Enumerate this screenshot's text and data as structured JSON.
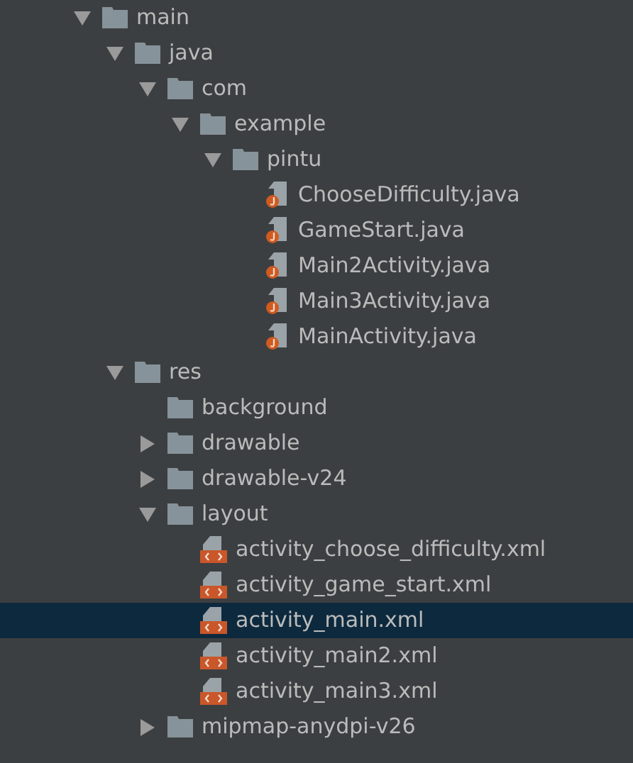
{
  "tree": [
    {
      "name": "main",
      "kind": "folder",
      "expanded": true,
      "selected": false,
      "children": [
        {
          "name": "java",
          "kind": "folder",
          "expanded": true,
          "selected": false,
          "children": [
            {
              "name": "com",
              "kind": "folder",
              "expanded": true,
              "selected": false,
              "children": [
                {
                  "name": "example",
                  "kind": "folder",
                  "expanded": true,
                  "selected": false,
                  "children": [
                    {
                      "name": "pintu",
                      "kind": "folder",
                      "expanded": true,
                      "selected": false,
                      "children": [
                        {
                          "name": "ChooseDifficulty.java",
                          "kind": "java",
                          "selected": false
                        },
                        {
                          "name": "GameStart.java",
                          "kind": "java",
                          "selected": false
                        },
                        {
                          "name": "Main2Activity.java",
                          "kind": "java",
                          "selected": false
                        },
                        {
                          "name": "Main3Activity.java",
                          "kind": "java",
                          "selected": false
                        },
                        {
                          "name": "MainActivity.java",
                          "kind": "java",
                          "selected": false
                        }
                      ]
                    }
                  ]
                }
              ]
            }
          ]
        },
        {
          "name": "res",
          "kind": "folder",
          "expanded": true,
          "selected": false,
          "children": [
            {
              "name": "background",
              "kind": "folder",
              "selected": false
            },
            {
              "name": "drawable",
              "kind": "folder",
              "expanded": false,
              "selected": false
            },
            {
              "name": "drawable-v24",
              "kind": "folder",
              "expanded": false,
              "selected": false
            },
            {
              "name": "layout",
              "kind": "folder",
              "expanded": true,
              "selected": false,
              "children": [
                {
                  "name": "activity_choose_difficulty.xml",
                  "kind": "xml",
                  "selected": false
                },
                {
                  "name": "activity_game_start.xml",
                  "kind": "xml",
                  "selected": false
                },
                {
                  "name": "activity_main.xml",
                  "kind": "xml",
                  "selected": true
                },
                {
                  "name": "activity_main2.xml",
                  "kind": "xml",
                  "selected": false
                },
                {
                  "name": "activity_main3.xml",
                  "kind": "xml",
                  "selected": false
                }
              ]
            },
            {
              "name": "mipmap-anydpi-v26",
              "kind": "folder",
              "expanded": false,
              "selected": false
            }
          ]
        }
      ]
    }
  ]
}
